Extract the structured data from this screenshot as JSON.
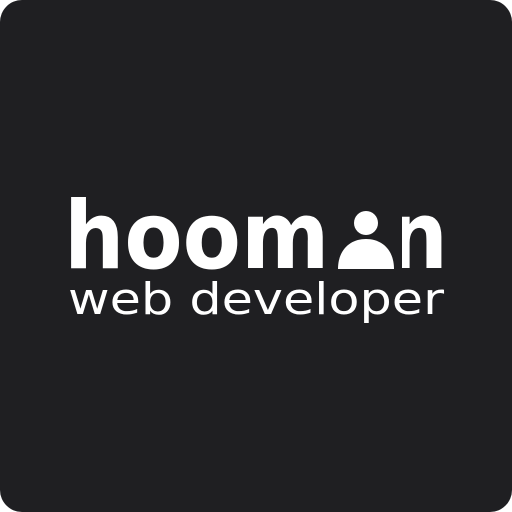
{
  "logo": {
    "wordmark": "hoomon",
    "tagline": "web developer",
    "person_icon": "person-icon"
  },
  "colors": {
    "background": "#1f1f22",
    "foreground": "#ffffff"
  }
}
